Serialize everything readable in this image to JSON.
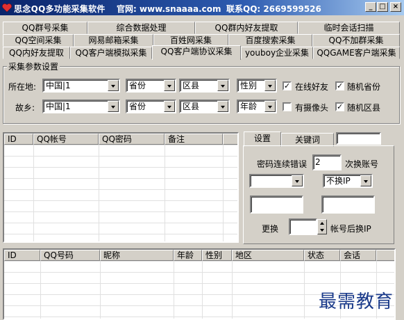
{
  "window": {
    "title": "思念QQ多功能采集软件",
    "site": "官网: www.snaaaa.com",
    "contact": "联系QQ: 2669599526",
    "min_label": "_",
    "max_label": "□",
    "close_label": "×"
  },
  "tabs": {
    "row1": [
      "QQ群号采集",
      "综合数据处理",
      "QQ群内好友提取",
      "临时会话扫描"
    ],
    "row2": [
      "QQ空间采集",
      "网易邮箱采集",
      "百姓网采集",
      "百度搜索采集",
      "QQ不加群采集"
    ],
    "row3": [
      "QQ内好友提取",
      "QQ客户端模拟采集",
      "QQ客户端协议采集",
      "youboy企业采集",
      "QQGAME客户端采集"
    ],
    "active": "QQ客户端协议采集"
  },
  "params": {
    "legend": "采集参数设置",
    "location_label": "所在地:",
    "hometown_label": "故乡:",
    "location_country": "中国|1",
    "location_province": "省份",
    "location_county": "区县",
    "gender": "性别",
    "hometown_country": "中国|1",
    "hometown_province": "省份",
    "hometown_county": "区县",
    "age": "年龄",
    "online_friend": "在线好友",
    "random_province": "随机省份",
    "has_camera": "有摄像头",
    "random_county": "随机区县",
    "online_friend_checked": true,
    "random_province_checked": true,
    "has_camera_checked": false,
    "random_county_checked": true
  },
  "accounts_table": {
    "columns": [
      "ID",
      "QQ帐号",
      "QQ密码",
      "备注"
    ]
  },
  "settings_panel": {
    "tab_settings": "设置",
    "tab_keywords": "关键词",
    "keyword_value": "",
    "pwd_error_label": "密码连续错误",
    "pwd_error_value": "2",
    "switch_account_label": "次换账号",
    "dropdown_left_value": "",
    "ip_mode": "不换IP",
    "replace_label": "更换",
    "replace_value": "",
    "after_account_label": "帐号后换IP"
  },
  "results_table": {
    "columns": [
      "ID",
      "QQ号码",
      "昵称",
      "年龄",
      "性别",
      "地区",
      "状态",
      "会话"
    ]
  },
  "watermark": "最需教育"
}
